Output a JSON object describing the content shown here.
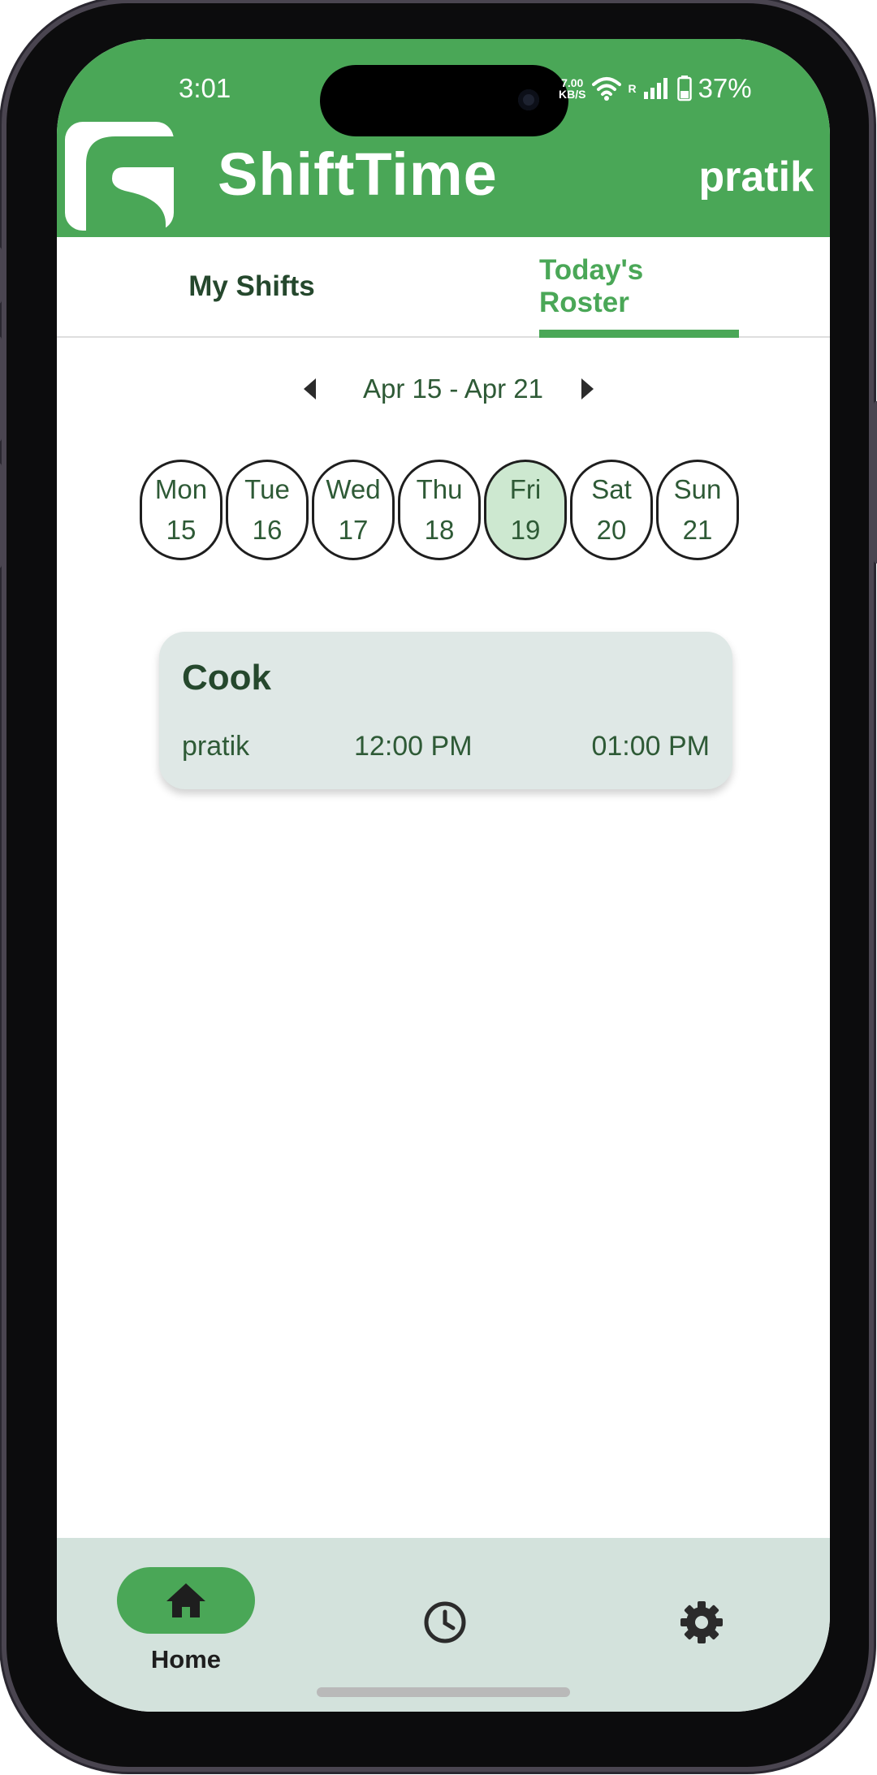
{
  "status_bar": {
    "time": "3:01",
    "net_speed_value": "7.00",
    "net_speed_unit": "KB/S",
    "signal_label": "R",
    "battery": "37%"
  },
  "header": {
    "app_title": "ShiftTime",
    "user_name": "pratik",
    "logo_letter": "S"
  },
  "tabs": [
    {
      "label": "My Shifts",
      "active": false
    },
    {
      "label": "Today's Roster",
      "active": true
    }
  ],
  "week": {
    "label": "Apr 15 - Apr 21",
    "days": [
      {
        "name": "Mon",
        "num": "15",
        "selected": false
      },
      {
        "name": "Tue",
        "num": "16",
        "selected": false
      },
      {
        "name": "Wed",
        "num": "17",
        "selected": false
      },
      {
        "name": "Thu",
        "num": "18",
        "selected": false
      },
      {
        "name": "Fri",
        "num": "19",
        "selected": true
      },
      {
        "name": "Sat",
        "num": "20",
        "selected": false
      },
      {
        "name": "Sun",
        "num": "21",
        "selected": false
      }
    ]
  },
  "shift": {
    "role": "Cook",
    "user": "pratik",
    "start": "12:00 PM",
    "end": "01:00 PM"
  },
  "bottom_nav": {
    "home_label": "Home",
    "items": [
      "home-icon",
      "clock-icon",
      "gear-icon"
    ]
  },
  "colors": {
    "brand_green": "#4aa757",
    "dark_green_text": "#25482d",
    "selected_day_bg": "#cde8d0",
    "card_bg": "#dfe8e6",
    "nav_bg": "#d3e2dc"
  }
}
